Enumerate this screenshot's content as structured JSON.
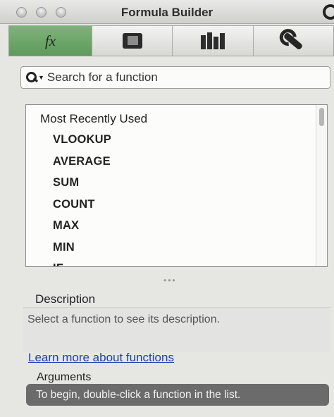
{
  "window": {
    "title": "Formula Builder"
  },
  "toolbar": {
    "tabs": [
      {
        "label": "fx",
        "icon": "function-icon",
        "active": true
      },
      {
        "icon": "formula-book-icon",
        "active": false
      },
      {
        "icon": "library-icon",
        "active": false
      },
      {
        "icon": "wrench-icon",
        "active": false
      }
    ]
  },
  "search": {
    "placeholder": "Search for a function"
  },
  "function_list": {
    "header": "Most Recently Used",
    "items": [
      "VLOOKUP",
      "AVERAGE",
      "SUM",
      "COUNT",
      "MAX",
      "MIN",
      "IF"
    ]
  },
  "description": {
    "label": "Description",
    "text": "Select a function to see its description.",
    "link": "Learn more about functions"
  },
  "arguments": {
    "label": "Arguments",
    "text": "To begin, double-click a function in the list."
  },
  "colors": {
    "active_tab": "#6ea86a",
    "link": "#1c3fb0",
    "arguments_bar": "#6b6b6b"
  }
}
